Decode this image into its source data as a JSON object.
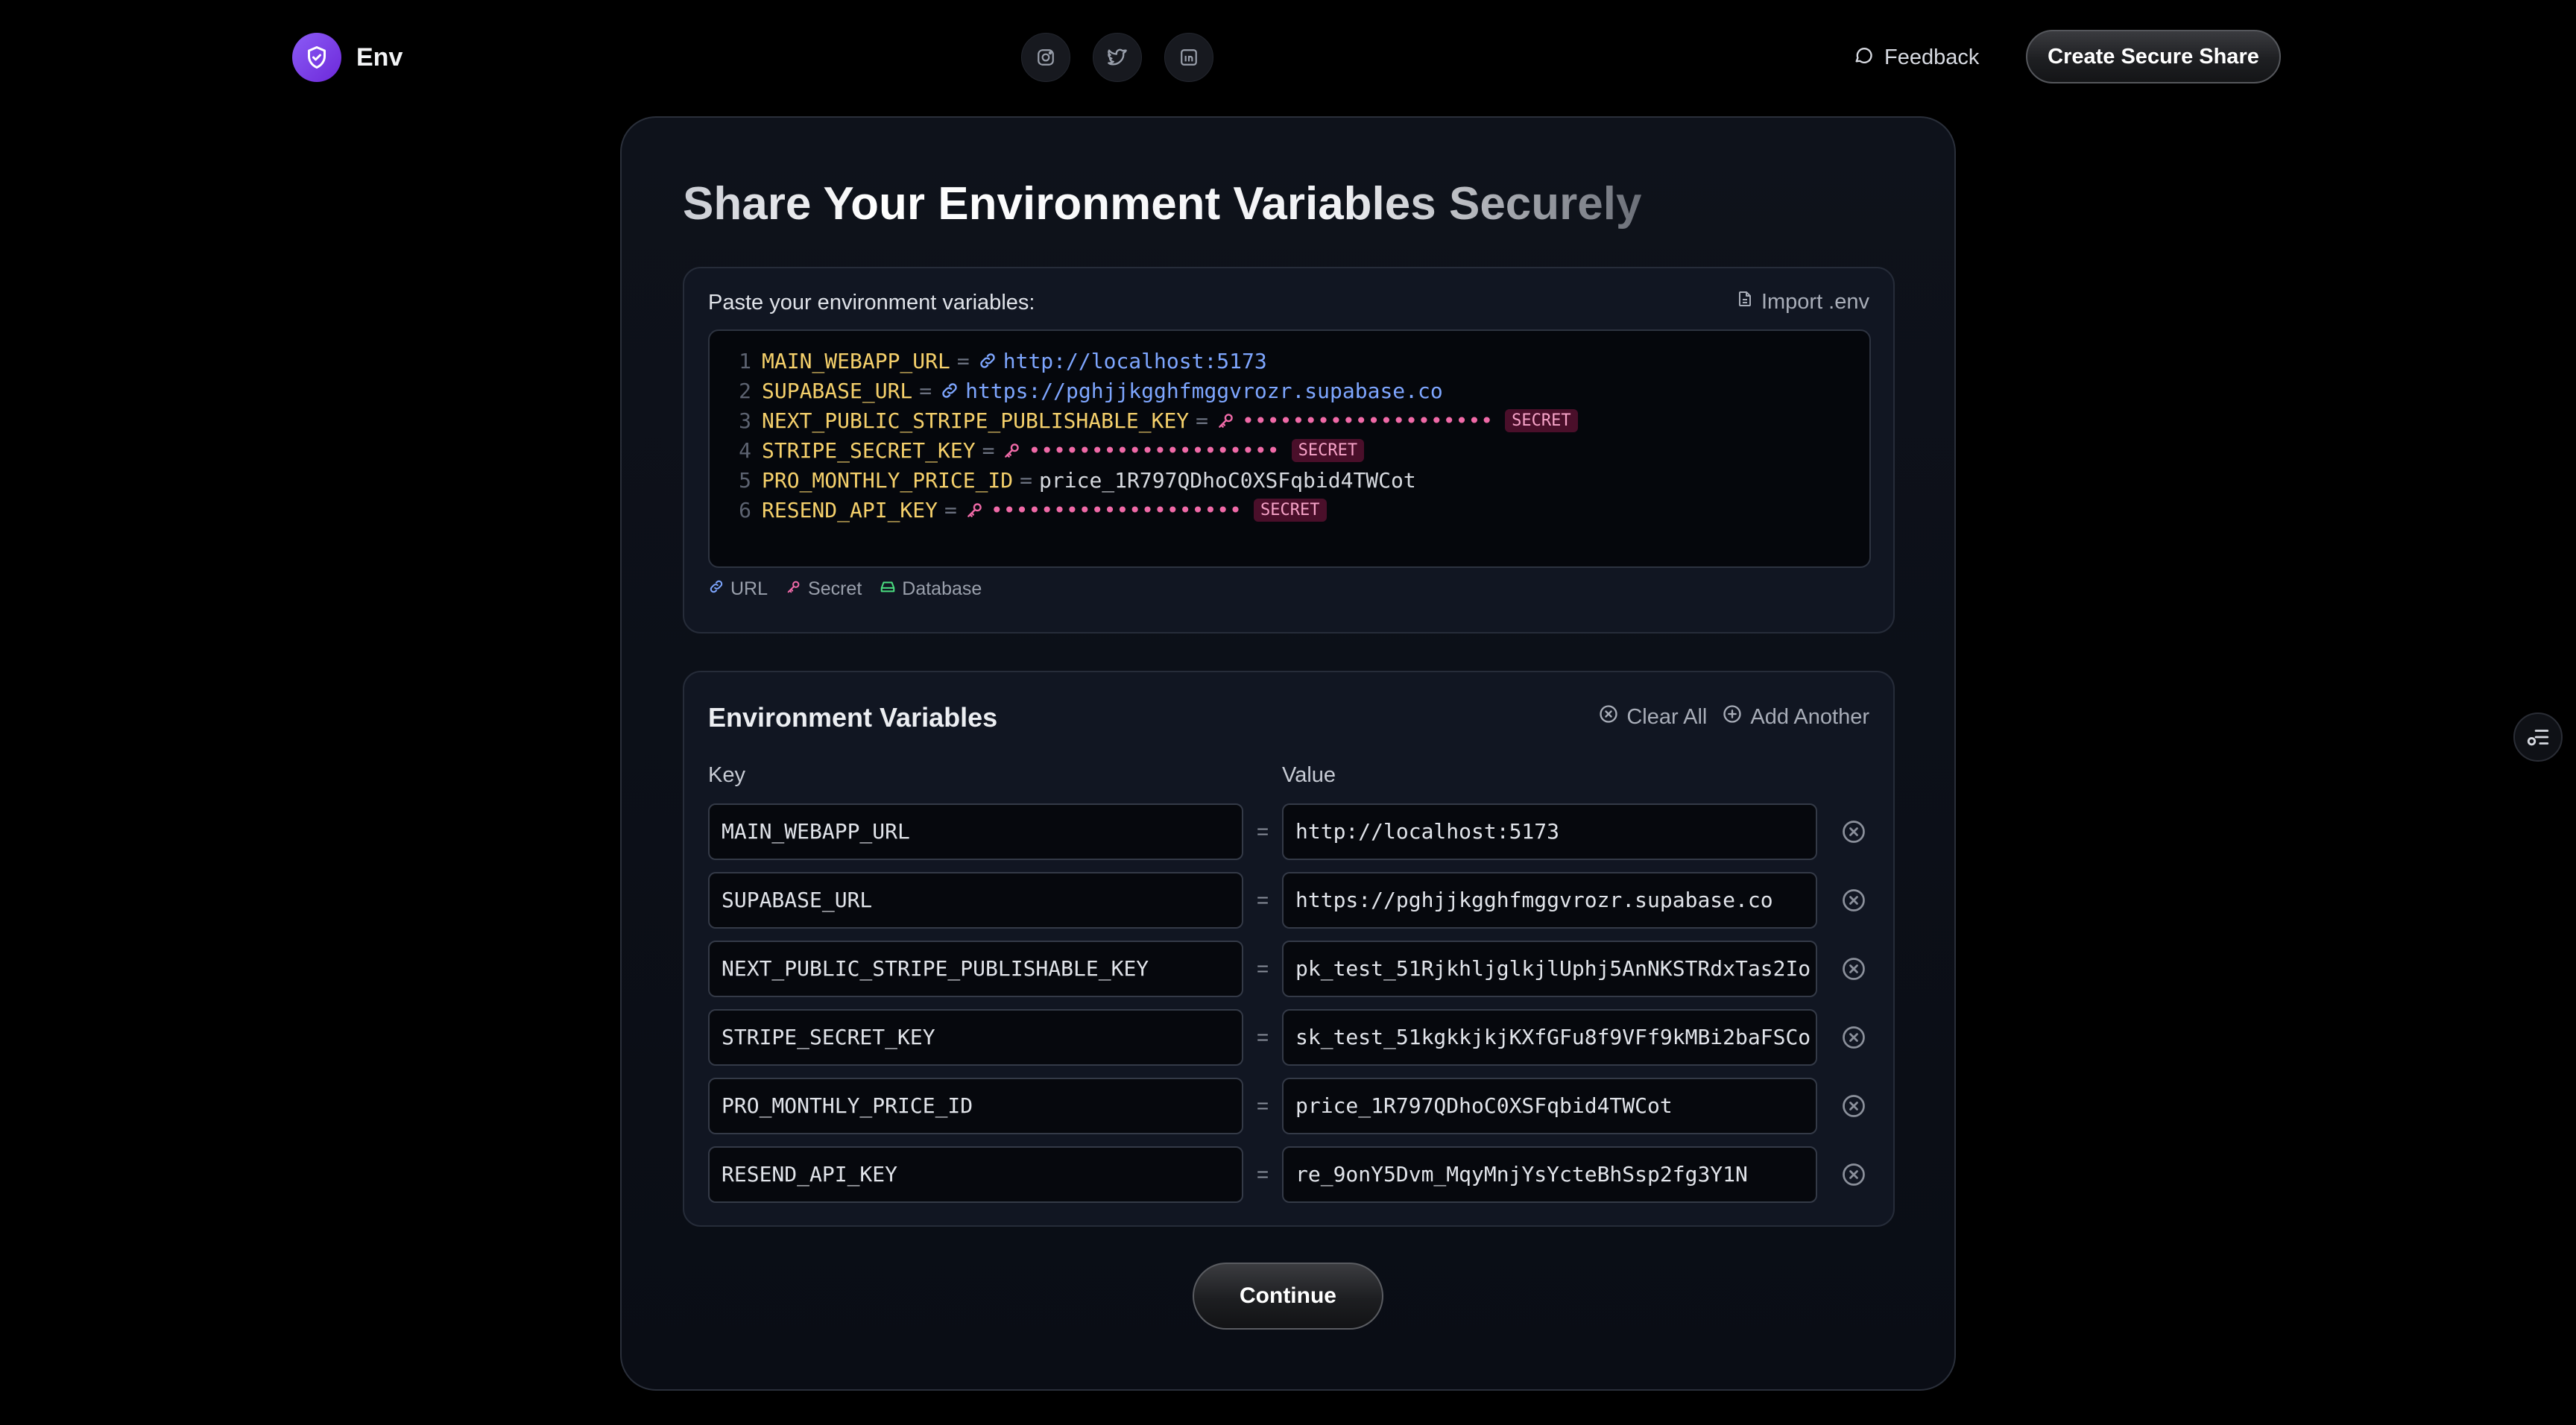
{
  "header": {
    "brand_name": "Env",
    "socials": [
      "instagram-icon",
      "twitter-icon",
      "linkedin-icon"
    ],
    "feedback_label": "Feedback",
    "cta_label": "Create Secure Share"
  },
  "main": {
    "title": "Share Your Environment Variables Securely",
    "paste": {
      "label": "Paste your environment variables:",
      "import_label": "Import .env",
      "equals": "=",
      "lines": [
        {
          "n": "1",
          "key": "MAIN_WEBAPP_URL",
          "type": "url",
          "value": "http://localhost:5173"
        },
        {
          "n": "2",
          "key": "SUPABASE_URL",
          "type": "url",
          "value": "https://pghjjkgghfmggvrozr.supabase.co"
        },
        {
          "n": "3",
          "key": "NEXT_PUBLIC_STRIPE_PUBLISHABLE_KEY",
          "type": "secret",
          "value": "••••••••••••••••••••",
          "badge": "SECRET"
        },
        {
          "n": "4",
          "key": "STRIPE_SECRET_KEY",
          "type": "secret",
          "value": "••••••••••••••••••••",
          "badge": "SECRET"
        },
        {
          "n": "5",
          "key": "PRO_MONTHLY_PRICE_ID",
          "type": "plain",
          "value": "price_1R797QDhoC0XSFqbid4TWCot"
        },
        {
          "n": "6",
          "key": "RESEND_API_KEY",
          "type": "secret",
          "value": "••••••••••••••••••••",
          "badge": "SECRET"
        }
      ],
      "legend": {
        "url": "URL",
        "secret": "Secret",
        "database": "Database"
      }
    },
    "env": {
      "title": "Environment Variables",
      "clear_all": "Clear All",
      "add_another": "Add Another",
      "key_header": "Key",
      "value_header": "Value",
      "equals": "=",
      "rows": [
        {
          "key": "MAIN_WEBAPP_URL",
          "value": "http://localhost:5173"
        },
        {
          "key": "SUPABASE_URL",
          "value": "https://pghjjkgghfmggvrozr.supabase.co"
        },
        {
          "key": "NEXT_PUBLIC_STRIPE_PUBLISHABLE_KEY",
          "value": "pk_test_51RjkhljglkjlUphj5AnNKSTRdxTas2Io"
        },
        {
          "key": "STRIPE_SECRET_KEY",
          "value": "sk_test_51kgkkjkjKXfGFu8f9VFf9kMBi2baFSCo"
        },
        {
          "key": "PRO_MONTHLY_PRICE_ID",
          "value": "price_1R797QDhoC0XSFqbid4TWCot"
        },
        {
          "key": "RESEND_API_KEY",
          "value": "re_9onY5Dvm_MqyMnjYsYcteBhSsp2fg3Y1N"
        }
      ]
    },
    "continue_label": "Continue"
  },
  "colors": {
    "accent": "#7c3aed",
    "key": "#f5d06b",
    "url": "#7ea6ff",
    "secret": "#f06aa8",
    "database": "#4ade80"
  }
}
